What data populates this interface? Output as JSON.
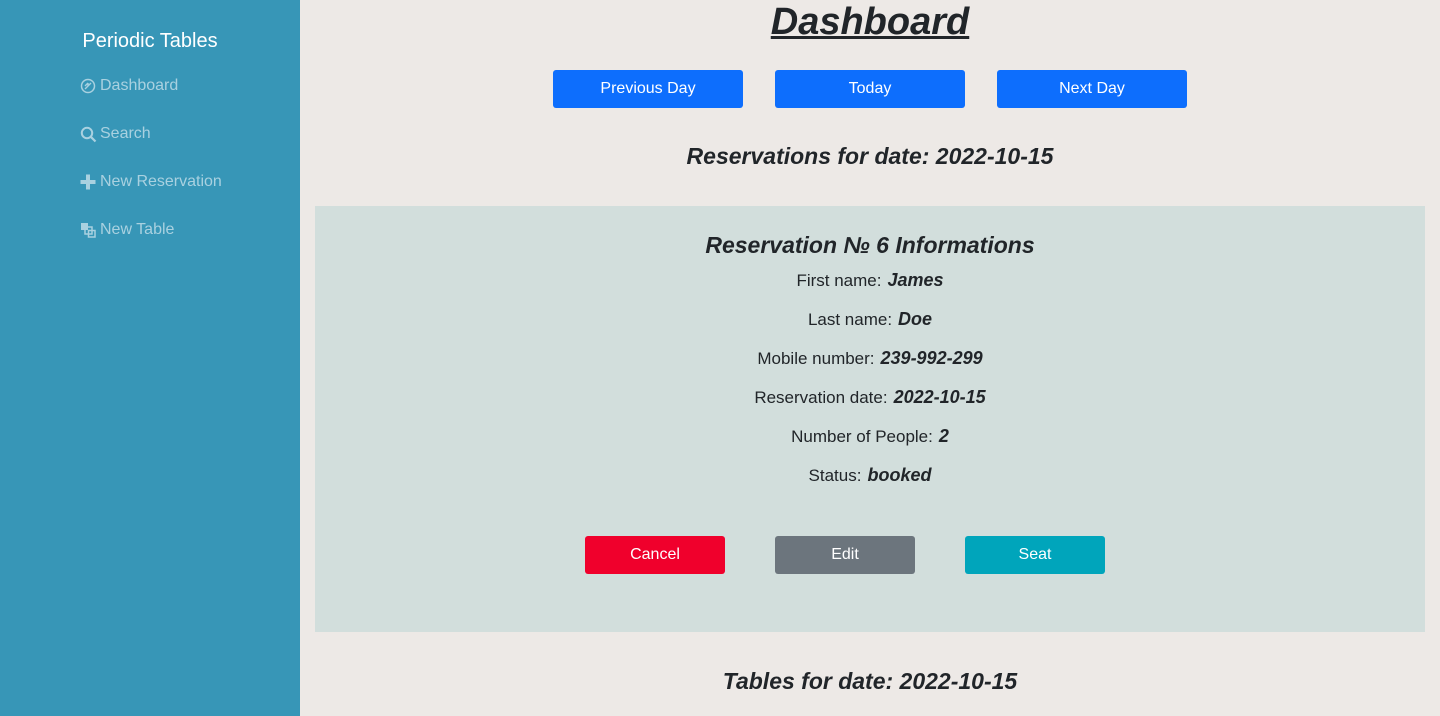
{
  "sidebar": {
    "brand": "Periodic Tables",
    "items": [
      {
        "label": "Dashboard",
        "icon": "dashboard-icon"
      },
      {
        "label": "Search",
        "icon": "search-icon"
      },
      {
        "label": "New Reservation",
        "icon": "plus-icon"
      },
      {
        "label": "New Table",
        "icon": "layers-icon"
      }
    ]
  },
  "main": {
    "title": "Dashboard",
    "nav_buttons": {
      "previous": "Previous Day",
      "today": "Today",
      "next": "Next Day"
    },
    "reservations_heading": "Reservations for date: 2022-10-15",
    "tables_heading": "Tables for date: 2022-10-15"
  },
  "reservation": {
    "title": "Reservation № 6 Informations",
    "fields": [
      {
        "label": "First name:",
        "value": "James"
      },
      {
        "label": "Last name:",
        "value": "Doe"
      },
      {
        "label": "Mobile number:",
        "value": "239-992-299"
      },
      {
        "label": "Reservation date:",
        "value": "2022-10-15"
      },
      {
        "label": "Number of People:",
        "value": "2"
      },
      {
        "label": "Status:",
        "value": "booked"
      }
    ],
    "actions": {
      "cancel": "Cancel",
      "edit": "Edit",
      "seat": "Seat"
    }
  },
  "colors": {
    "sidebar": "#3796b7",
    "primary": "#0d6efd",
    "danger": "#f0002c",
    "secondary": "#6c757d",
    "info": "#00a5bb",
    "card": "#d2dedc",
    "page": "#ede9e6"
  }
}
